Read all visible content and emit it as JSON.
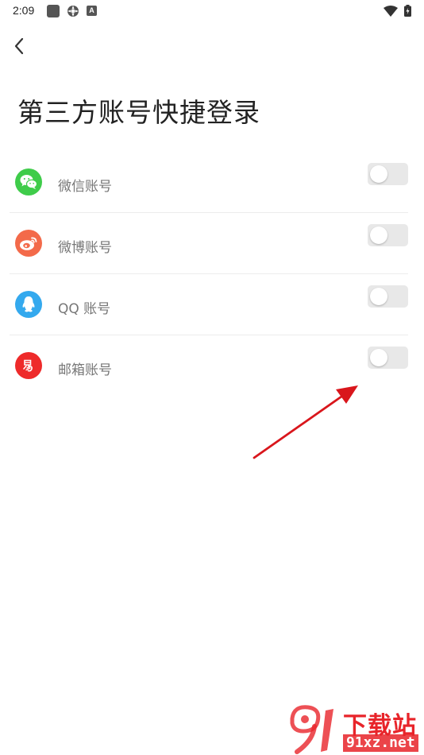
{
  "status_bar": {
    "time": "2:09",
    "font_badge": "A",
    "icons": [
      "square-notification-icon",
      "gear-notification-icon",
      "font-notification-icon",
      "wifi-icon",
      "battery-icon"
    ]
  },
  "page": {
    "title": "第三方账号快捷登录"
  },
  "accounts": [
    {
      "label": "微信账号",
      "icon": "wechat-icon",
      "color": "#3fcc4a",
      "enabled": false
    },
    {
      "label": "微博账号",
      "icon": "weibo-icon",
      "color": "#f36a4a",
      "enabled": false
    },
    {
      "label": "QQ 账号",
      "icon": "qq-icon",
      "color": "#34a9ee",
      "enabled": false
    },
    {
      "label": "邮箱账号",
      "icon": "netease-mail-icon",
      "color": "#ee2a2a",
      "enabled": false
    }
  ],
  "annotation": {
    "color": "#d9161c"
  },
  "watermark": {
    "title": "下载站",
    "domain": "91xz.net",
    "color": "#e8242a"
  }
}
